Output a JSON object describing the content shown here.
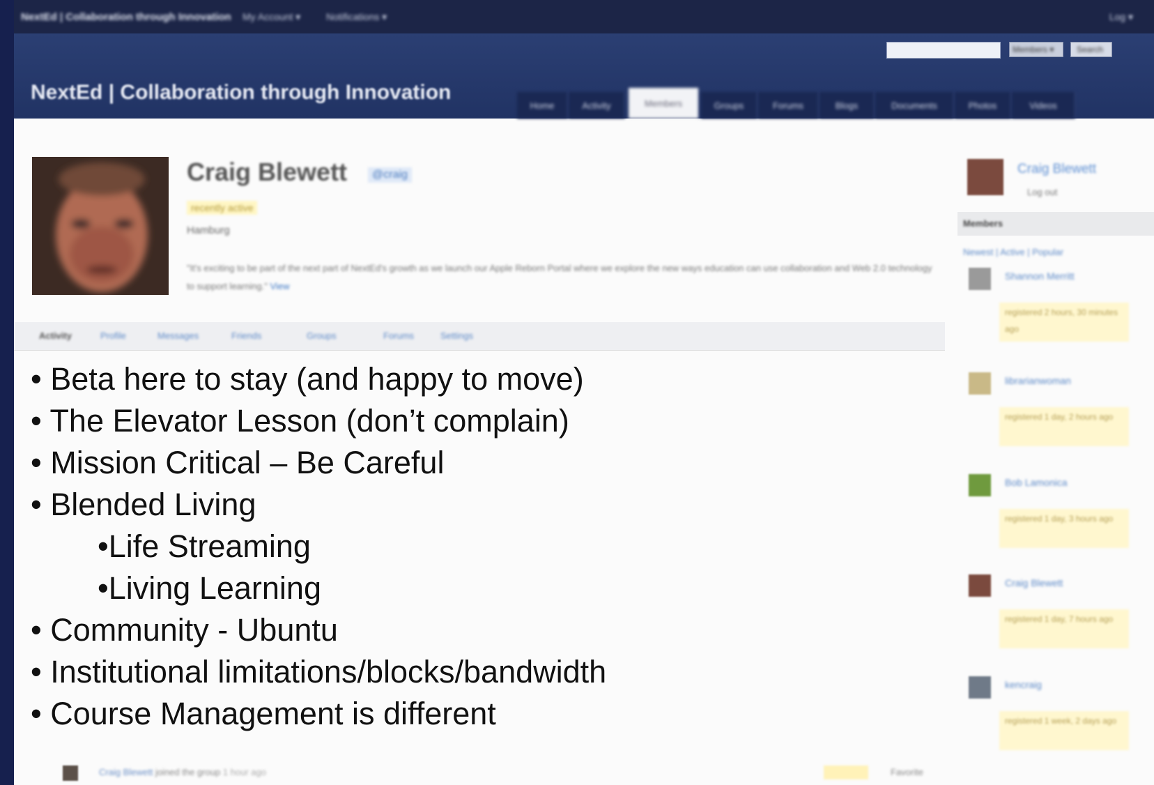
{
  "topbar": {
    "brand": "NextEd | Collaboration through Innovation",
    "menus": [
      {
        "label": "My Account ▾"
      },
      {
        "label": "Notifications ▾"
      }
    ],
    "corner": "Log ▾"
  },
  "header": {
    "title": "NextEd | Collaboration through Innovation",
    "search_value": "",
    "search_scope": "Members ▾",
    "search_button": "Search",
    "nav": [
      {
        "label": "Home"
      },
      {
        "label": "Activity"
      },
      {
        "label": "Members"
      },
      {
        "label": "Groups"
      },
      {
        "label": "Forums"
      },
      {
        "label": "Blogs"
      },
      {
        "label": "Documents"
      },
      {
        "label": "Photos"
      },
      {
        "label": "Videos"
      }
    ]
  },
  "profile": {
    "name": "Craig Blewett",
    "handle": "@craig",
    "status": "recently active",
    "location": "Hamburg",
    "quote": "\"It's exciting to be part of the next part of NextEd's growth as we launch our Apple Reborn Portal where we explore the new ways education can use collaboration and Web 2.0 technology to support learning.\"",
    "quote_link": "View"
  },
  "profile_tabs": [
    {
      "label": "Activity"
    },
    {
      "label": "Profile"
    },
    {
      "label": "Messages"
    },
    {
      "label": "Friends"
    },
    {
      "label": "Groups"
    },
    {
      "label": "Forums"
    },
    {
      "label": "Settings"
    }
  ],
  "bullets": [
    {
      "text": "• Beta here to stay (and happy to move)"
    },
    {
      "text": "• The Elevator Lesson (don’t complain)"
    },
    {
      "text": "• Mission Critical – Be Careful"
    },
    {
      "text": "• Blended Living"
    },
    {
      "text": "•Life Streaming"
    },
    {
      "text": "•Living Learning"
    },
    {
      "text": "• Community - Ubuntu"
    },
    {
      "text": "• Institutional limitations/blocks/bandwidth"
    },
    {
      "text": "• Course Management is different"
    }
  ],
  "feed": {
    "user": "Craig Blewett",
    "text": "joined the group",
    "time": "1 hour ago",
    "action": "Favorite"
  },
  "sidebar": {
    "me_name": "Craig Blewett",
    "me_sub": "Log out",
    "section_title": "Members",
    "section_link": "Newest | Active | Popular",
    "members": [
      {
        "name": "Shannon Merritt",
        "note": "registered 2 hours, 30 minutes ago",
        "color": "#9a9a9a"
      },
      {
        "name": "librarianwoman",
        "note": "registered 1 day, 2 hours ago",
        "color": "#c9b987"
      },
      {
        "name": "Bob Lamonica",
        "note": "registered 1 day, 3 hours ago",
        "color": "#6f9a3e"
      },
      {
        "name": "Craig Blewett",
        "note": "registered 1 day, 7 hours ago",
        "color": "#7b4a3e"
      },
      {
        "name": "kencraig",
        "note": "registered 1 week, 2 days ago",
        "color": "#6f7a88"
      }
    ]
  }
}
